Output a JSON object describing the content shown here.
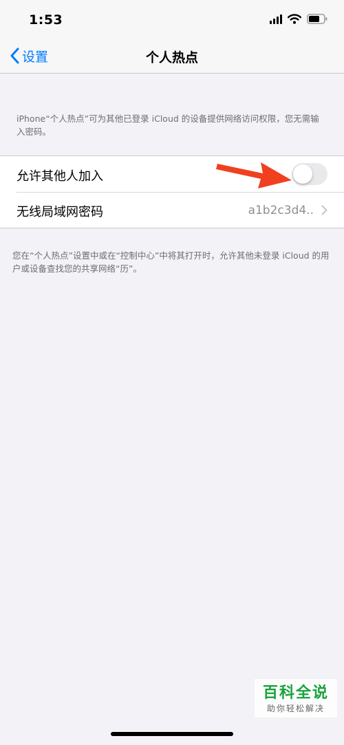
{
  "status_bar": {
    "time": "1:53",
    "icons": [
      "cellular-signal-icon",
      "wifi-icon",
      "battery-icon"
    ]
  },
  "nav": {
    "back_label": "设置",
    "title": "个人热点"
  },
  "header_note": "iPhone“个人热点”可为其他已登录 iCloud 的设备提供网络访问权限，您无需输入密码。",
  "settings": {
    "allow_others": {
      "label": "允许其他人加入",
      "enabled": false
    },
    "wifi_password": {
      "label": "无线局域网密码",
      "value": "a1b2c3d4.."
    }
  },
  "footer_note": "您在“个人热点”设置中或在“控制中心”中将其打开时，允许其他未登录 iCloud 的用户或设备查找您的共享网络“历”。",
  "watermark": {
    "title": "百科全说",
    "subtitle": "助你轻松解决"
  },
  "colors": {
    "accent": "#007aff",
    "arrow": "#f0401f",
    "watermark": "#17a33a",
    "background": "#f2f2f7"
  }
}
